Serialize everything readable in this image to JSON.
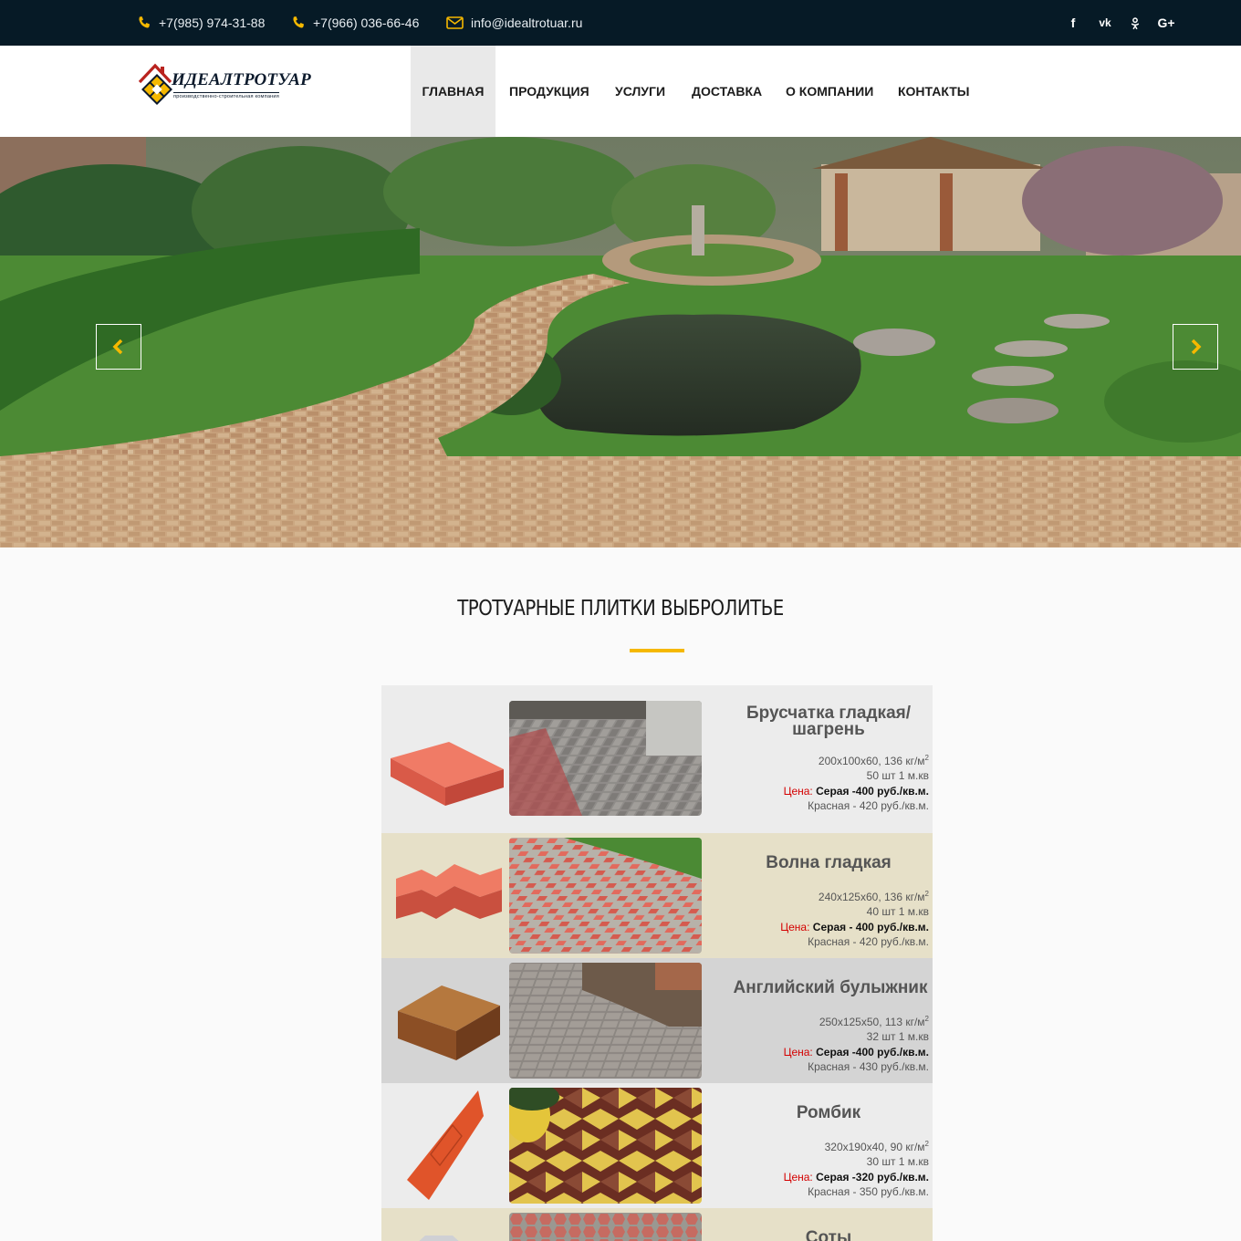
{
  "topbar": {
    "phone1": "+7(985) 974-31-88",
    "phone2": "+7(966) 036-66-46",
    "email": "info@idealtrotuar.ru",
    "social": [
      "f",
      "vk",
      "ok",
      "G+"
    ]
  },
  "logo": {
    "name": "ИДЕАЛТРОТУАР",
    "subtitle": "производственно-строительная компания"
  },
  "nav": [
    "ГЛАВНАЯ",
    "ПРОДУКЦИЯ",
    "УСЛУГИ",
    "ДОСТАВКА",
    "О КОМПАНИИ",
    "КОНТАКТЫ"
  ],
  "section": {
    "title": "ТРОТУАРНЫЕ ПЛИТКИ ВЫБРОЛИТЬЕ"
  },
  "products": [
    {
      "name": "Брусчатка гладкая/ шагрень",
      "size": "200x100x60, 136 кг/м",
      "sup": "2",
      "qty": "50 шт 1 м.кв",
      "price_label": "Цена:",
      "price_gray": "Серая -400 руб./кв.м.",
      "price_red": "Красная - 420 руб./кв.м."
    },
    {
      "name": "Волна гладкая",
      "size": "240x125x60, 136 кг/м",
      "sup": "2",
      "qty": "40 шт 1 м.кв",
      "price_label": "Цена:",
      "price_gray": "Серая - 400 руб./кв.м.",
      "price_red": "Красная - 420 руб./кв.м."
    },
    {
      "name": "Английский булыжник",
      "size": "250x125x50, 113 кг/м",
      "sup": "2",
      "qty": "32 шт 1 м.кв",
      "price_label": "Цена:",
      "price_gray": "Серая -400 руб./кв.м.",
      "price_red": "Красная - 430 руб./кв.м."
    },
    {
      "name": "Ромбик",
      "size": "320x190x40, 90 кг/м",
      "sup": "2",
      "qty": "30 шт 1 м.кв",
      "price_label": "Цена:",
      "price_gray": "Серая -320 руб./кв.м.",
      "price_red": "Красная - 350 руб./кв.м."
    },
    {
      "name": "Соты"
    }
  ],
  "colors": {
    "topbar": "#061a26",
    "accent": "#f5b800",
    "price_label": "#d40000"
  }
}
